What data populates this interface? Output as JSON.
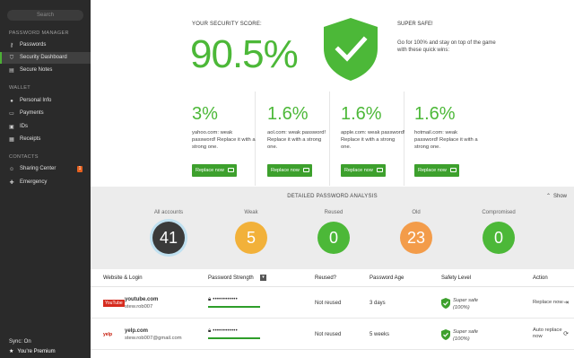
{
  "sidebar": {
    "search_placeholder": "Search",
    "sections": {
      "password_manager": "PASSWORD MANAGER",
      "wallet": "WALLET",
      "contacts": "CONTACTS"
    },
    "items": [
      {
        "label": "Passwords",
        "icon": "key-icon"
      },
      {
        "label": "Security Dashboard",
        "icon": "shield-icon",
        "active": true
      },
      {
        "label": "Secure Notes",
        "icon": "note-icon"
      },
      {
        "label": "Personal Info",
        "icon": "person-icon"
      },
      {
        "label": "Payments",
        "icon": "card-icon"
      },
      {
        "label": "IDs",
        "icon": "id-icon"
      },
      {
        "label": "Receipts",
        "icon": "receipt-icon"
      },
      {
        "label": "Sharing Center",
        "icon": "sharing-icon",
        "badge": "1"
      },
      {
        "label": "Emergency",
        "icon": "emergency-icon"
      }
    ],
    "sync_status": "Sync: On",
    "premium_label": "You're Premium"
  },
  "score": {
    "label": "YOUR SECURITY SCORE:",
    "value": "90.5%",
    "safe_title": "SUPER SAFE!",
    "safe_desc": "Go for 100% and stay on top of the game with these quick wins:"
  },
  "cards": [
    {
      "percent": "3%",
      "desc": "yahoo.com: weak password! Replace it with a strong one.",
      "button": "Replace now"
    },
    {
      "percent": "1.6%",
      "desc": "aol.com: weak password! Replace it with a strong one.",
      "button": "Replace now"
    },
    {
      "percent": "1.6%",
      "desc": "apple.com: weak password! Replace it with a strong one.",
      "button": "Replace now"
    },
    {
      "percent": "1.6%",
      "desc": "hotmail.com: weak password! Replace it with a strong one.",
      "button": "Replace now"
    }
  ],
  "analysis": {
    "title": "DETAILED PASSWORD ANALYSIS",
    "toggle": "Show",
    "stats": [
      {
        "label": "All accounts",
        "value": "41",
        "color": "#3a3a3a"
      },
      {
        "label": "Weak",
        "value": "5",
        "color": "#f2b13a"
      },
      {
        "label": "Reused",
        "value": "0",
        "color": "#4cb838"
      },
      {
        "label": "Old",
        "value": "23",
        "color": "#f39c4a"
      },
      {
        "label": "Compromised",
        "value": "0",
        "color": "#4cb838"
      }
    ]
  },
  "table": {
    "headers": {
      "website": "Website & Login",
      "strength": "Password Strength",
      "reused": "Reused?",
      "age": "Password Age",
      "safety": "Safety Level",
      "action": "Action"
    },
    "rows": [
      {
        "logo": "YouTube",
        "site": "youtube.com",
        "login": "stew.rob007",
        "password": "••••••••••••",
        "reused": "Not reused",
        "age": "3 days",
        "safety_1": "Super safe",
        "safety_2": "(100%)",
        "action_1": "Replace now",
        "action_2": ""
      },
      {
        "logo": "yelp",
        "site": "yelp.com",
        "login": "stew.rob007@gmail.com",
        "password": "••••••••••••",
        "reused": "Not reused",
        "age": "5 weeks",
        "safety_1": "Super safe",
        "safety_2": "(100%)",
        "action_1": "Auto replace",
        "action_2": "now"
      }
    ]
  },
  "colors": {
    "accent_green": "#4cb838",
    "button_green": "#3da02d",
    "sidebar_bg": "#2a2a2a",
    "badge_orange": "#e7611f"
  }
}
